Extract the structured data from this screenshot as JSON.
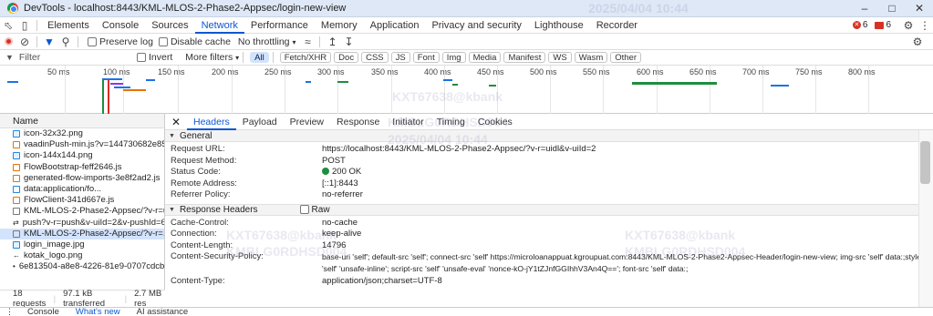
{
  "window": {
    "title": "DevTools - localhost:8443/KML-MLOS-2-Phase2-Appsec/login-new-view"
  },
  "tabs": [
    "Elements",
    "Console",
    "Sources",
    "Network",
    "Performance",
    "Memory",
    "Application",
    "Privacy and security",
    "Lighthouse",
    "Recorder"
  ],
  "active_tab": "Network",
  "status": {
    "errors": "6",
    "warnings": "6"
  },
  "toolbar": {
    "preserve_log": "Preserve log",
    "disable_cache": "Disable cache",
    "throttling": "No throttling"
  },
  "filter": {
    "placeholder": "Filter",
    "invert": "Invert",
    "more_filters": "More filters"
  },
  "filter_chips": [
    "All",
    "Fetch/XHR",
    "Doc",
    "CSS",
    "JS",
    "Font",
    "Img",
    "Media",
    "Manifest",
    "WS",
    "Wasm",
    "Other"
  ],
  "timeline": {
    "ticks": [
      "50 ms",
      "100 ms",
      "150 ms",
      "200 ms",
      "250 ms",
      "300 ms",
      "350 ms",
      "400 ms",
      "450 ms",
      "500 ms",
      "550 ms",
      "600 ms",
      "650 ms",
      "700 ms",
      "750 ms",
      "800 ms"
    ]
  },
  "request_list": {
    "header": "Name",
    "rows": [
      {
        "name": "icon-32x32.png",
        "type": "img"
      },
      {
        "name": "vaadinPush-min.js?v=144730682e85ba...",
        "type": "js"
      },
      {
        "name": "icon-144x144.png",
        "type": "img"
      },
      {
        "name": "FlowBootstrap-feff2646.js",
        "type": "js"
      },
      {
        "name": "generated-flow-imports-3e8f2ad2.js",
        "type": "js"
      },
      {
        "name": "data:application/fo...",
        "type": "doc"
      },
      {
        "name": "FlowClient-341d667e.js",
        "type": "js"
      },
      {
        "name": "KML-MLOS-2-Phase2-Appsec/?v-r=uidl...",
        "type": "fetch"
      },
      {
        "name": "push?v-r=push&v-uiId=2&v-pushId=6...",
        "type": "fetch"
      },
      {
        "name": "KML-MLOS-2-Phase2-Appsec/?v-r=...",
        "type": "fetch"
      },
      {
        "name": "login_image.jpg",
        "type": "img"
      },
      {
        "name": "kotak_logo.png",
        "type": "img"
      },
      {
        "name": "6e813504-a8e8-4226-81e9-0707cdcbf8...",
        "type": "fetch"
      }
    ],
    "selected_index": 9
  },
  "summary": {
    "requests": "18 requests",
    "transferred": "97.1 kB transferred",
    "resources": "2.7 MB res"
  },
  "detail_tabs": [
    "Headers",
    "Payload",
    "Preview",
    "Response",
    "Initiator",
    "Timing",
    "Cookies"
  ],
  "active_detail_tab": "Headers",
  "general": {
    "title": "General",
    "rows": [
      {
        "k": "Request URL:",
        "v": "https://localhost:8443/KML-MLOS-2-Phase2-Appsec/?v-r=uidl&v-uiId=2"
      },
      {
        "k": "Request Method:",
        "v": "POST"
      },
      {
        "k": "Status Code:",
        "v": "200 OK"
      },
      {
        "k": "Remote Address:",
        "v": "[::1]:8443"
      },
      {
        "k": "Referrer Policy:",
        "v": "no-referrer"
      }
    ]
  },
  "response_headers": {
    "title": "Response Headers",
    "raw": "Raw",
    "rows": [
      {
        "k": "Cache-Control:",
        "v": "no-cache"
      },
      {
        "k": "Connection:",
        "v": "keep-alive"
      },
      {
        "k": "Content-Length:",
        "v": "14796"
      },
      {
        "k": "Content-Security-Policy:",
        "v": "base-uri 'self'; default-src 'self'; connect-src 'self' https://microloanappuat.kgroupuat.com:8443/KML-MLOS-2-Phase2-Appsec-Header/login-new-view; img-src 'self' data:;style-src"
      },
      {
        "k": "",
        "v": "'self' 'unsafe-inline'; script-src 'self' 'unsafe-eval' 'nonce-kO-jY1tZJnfGGIhhV3An4Q=='; font-src 'self' data:;"
      },
      {
        "k": "Content-Type:",
        "v": "application/json;charset=UTF-8"
      }
    ]
  },
  "drawer": {
    "tabs": [
      "Console",
      "What's new",
      "AI assistance"
    ],
    "active": "What's new"
  },
  "watermarks": [
    "2025/04/04 10:44",
    "KXT67638@kbank",
    "KMBLG0RDHSD004",
    "2025/04/04 10:44",
    "KXT67638@kbank",
    "KMBLG0RDHSD004",
    "KXT67638@kbank",
    "KMBLG0RDHSD004"
  ],
  "colors": {
    "accent": "#0b57d0",
    "selected_row": "#d3e3fd",
    "status_ok": "#1e8e3e",
    "error": "#d93025"
  }
}
